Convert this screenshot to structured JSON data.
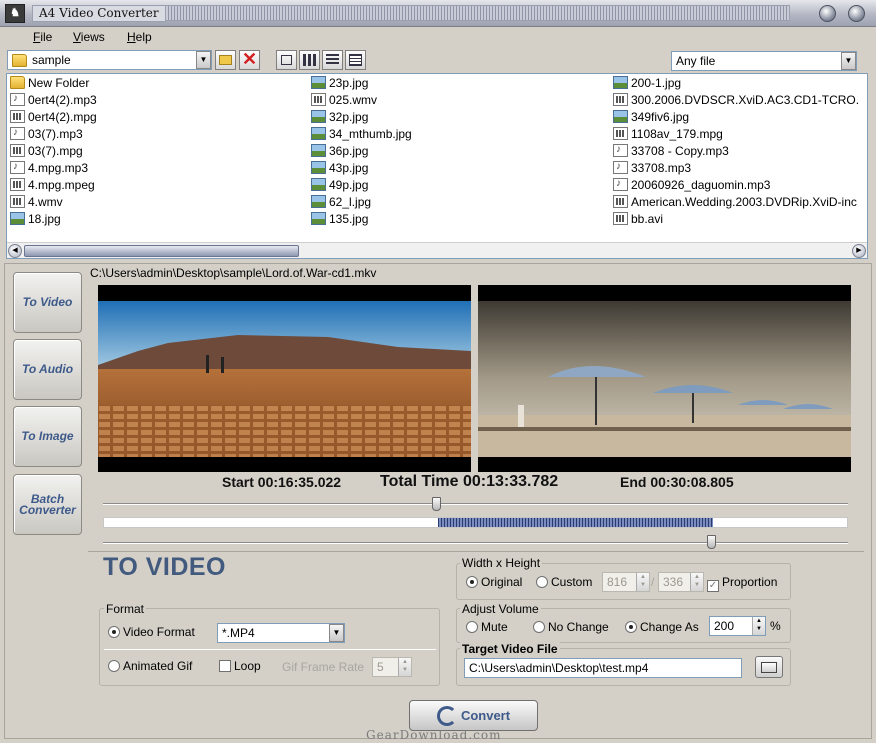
{
  "window": {
    "title": "A4 Video Converter"
  },
  "menu": [
    {
      "label": "File",
      "key": "F",
      "rest": "ile"
    },
    {
      "label": "Views",
      "key": "V",
      "rest": "iews"
    },
    {
      "label": "Help",
      "key": "H",
      "rest": "elp"
    }
  ],
  "path_combo": {
    "value": "sample"
  },
  "filter_combo": {
    "value": "Any file"
  },
  "files": {
    "col1": [
      {
        "name": "New Folder",
        "icon": "folder-icon"
      },
      {
        "name": "0ert4(2).mp3",
        "icon": "audio-file-icon"
      },
      {
        "name": "0ert4(2).mpg",
        "icon": "video-file-icon"
      },
      {
        "name": "03(7).mp3",
        "icon": "audio-file-icon"
      },
      {
        "name": "03(7).mpg",
        "icon": "video-file-icon"
      },
      {
        "name": "4.mpg.mp3",
        "icon": "audio-file-icon"
      },
      {
        "name": "4.mpg.mpeg",
        "icon": "video-file-icon"
      },
      {
        "name": "4.wmv",
        "icon": "video-file-icon"
      },
      {
        "name": "18.jpg",
        "icon": "image-file-icon"
      }
    ],
    "col2": [
      {
        "name": "23p.jpg",
        "icon": "image-file-icon"
      },
      {
        "name": "025.wmv",
        "icon": "video-file-icon"
      },
      {
        "name": "32p.jpg",
        "icon": "image-file-icon"
      },
      {
        "name": "34_mthumb.jpg",
        "icon": "image-file-icon"
      },
      {
        "name": "36p.jpg",
        "icon": "image-file-icon"
      },
      {
        "name": "43p.jpg",
        "icon": "image-file-icon"
      },
      {
        "name": "49p.jpg",
        "icon": "image-file-icon"
      },
      {
        "name": "62_l.jpg",
        "icon": "image-file-icon"
      },
      {
        "name": "135.jpg",
        "icon": "image-file-icon"
      }
    ],
    "col3": [
      {
        "name": "200-1.jpg",
        "icon": "image-file-icon"
      },
      {
        "name": "300.2006.DVDSCR.XviD.AC3.CD1-TCRO.",
        "icon": "video-file-icon"
      },
      {
        "name": "349fiv6.jpg",
        "icon": "image-file-icon"
      },
      {
        "name": "1108av_179.mpg",
        "icon": "video-file-icon"
      },
      {
        "name": "33708 - Copy.mp3",
        "icon": "audio-file-icon"
      },
      {
        "name": "33708.mp3",
        "icon": "audio-file-icon"
      },
      {
        "name": "20060926_daguomin.mp3",
        "icon": "audio-file-icon"
      },
      {
        "name": "American.Wedding.2003.DVDRip.XviD-inc",
        "icon": "video-file-icon"
      },
      {
        "name": "bb.avi",
        "icon": "video-file-icon"
      }
    ]
  },
  "sidebar": {
    "to_video": "To Video",
    "to_audio": "To Audio",
    "to_image": "To Image",
    "batch_line1": "Batch",
    "batch_line2": "Converter"
  },
  "current_file": "C:\\Users\\admin\\Desktop\\sample\\Lord.of.War-cd1.mkv",
  "timing": {
    "start": "Start 00:16:35.022",
    "total": "Total Time 00:13:33.782",
    "end": "End 00:30:08.805",
    "start_fraction": 0.448,
    "end_fraction": 0.818
  },
  "panel_title": "TO VIDEO",
  "format": {
    "legend": "Format",
    "video_format_label": "Video Format",
    "video_format_value": "*.MP4",
    "animated_gif_label": "Animated Gif",
    "loop_label": "Loop",
    "gif_rate_label": "Gif Frame Rate",
    "gif_rate_value": "5"
  },
  "size": {
    "legend": "Width x Height",
    "original_label": "Original",
    "custom_label": "Custom",
    "width": "816",
    "height": "336",
    "proportion_label": "Proportion"
  },
  "volume": {
    "legend": "Adjust Volume",
    "mute_label": "Mute",
    "no_change_label": "No Change",
    "change_as_label": "Change As",
    "value": "200",
    "unit": "%"
  },
  "target": {
    "legend": "Target Video File",
    "path": "C:\\Users\\admin\\Desktop\\test.mp4"
  },
  "convert_label": "Convert",
  "watermark": "GearDownload.com"
}
